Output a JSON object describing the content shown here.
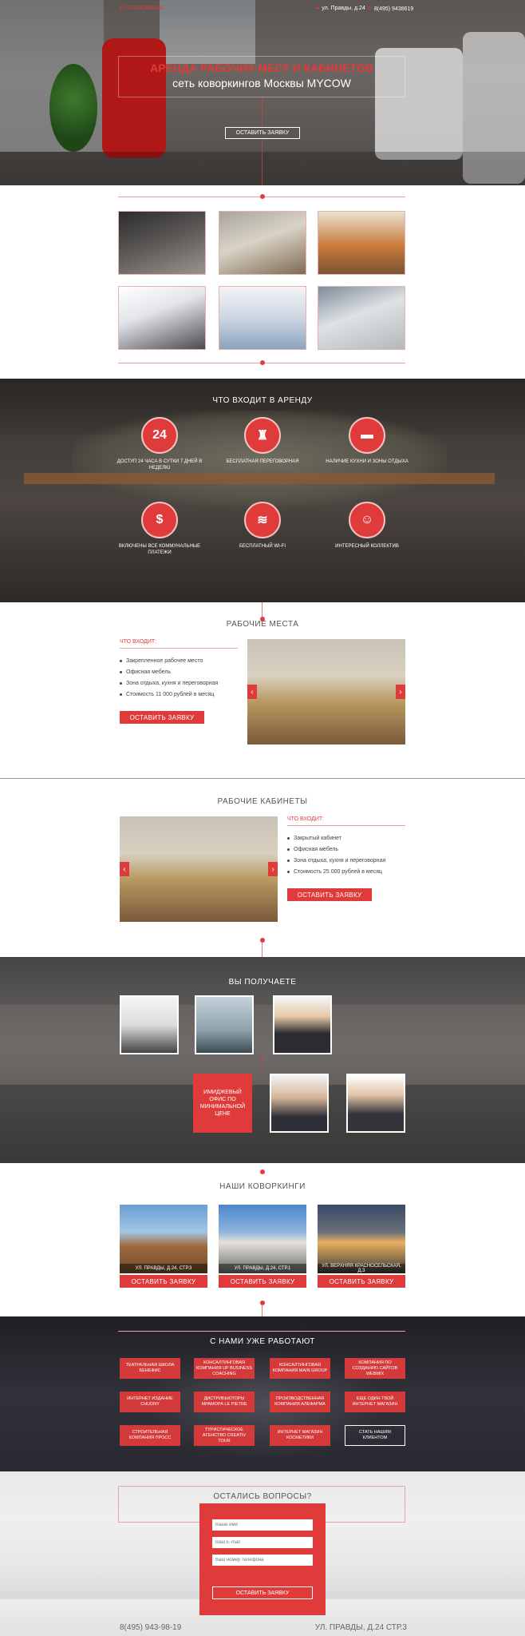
{
  "header": {
    "logo": "MYCOWORKING",
    "address": "ул. Правды, д.24",
    "phone": "8(495) 9438619"
  },
  "hero": {
    "title": "АРЕНДА РАБОЧИХ МЕСТ И КАБИНЕТОВ",
    "subtitle": "сеть коворкингов Москвы MYCOW",
    "button": "ОСТАВИТЬ ЗАЯВКУ"
  },
  "included": {
    "title": "ЧТО ВХОДИТ В АРЕНДУ",
    "features": [
      {
        "icon": "clock-24-icon",
        "glyph": "24",
        "label": "ДОСТУП 24 ЧАСА В СУТКИ 7 ДНЕЙ В НЕДЕЛЮ"
      },
      {
        "icon": "chair-icon",
        "glyph": "♜",
        "label": "БЕСПЛАТНАЯ ПЕРЕГОВОРНАЯ"
      },
      {
        "icon": "sofa-icon",
        "glyph": "▬",
        "label": "НАЛИЧИЕ КУХНИ И ЗОНЫ ОТДЫХА"
      },
      {
        "icon": "money-hand-icon",
        "glyph": "$",
        "label": "ВКЛЮЧЕНЫ ВСЕ КОММУНАЛЬНЫЕ ПЛАТЕЖИ"
      },
      {
        "icon": "wifi-icon",
        "glyph": "≋",
        "label": "БЕСПЛАТНЫЙ WI-FI"
      },
      {
        "icon": "people-icon",
        "glyph": "☺",
        "label": "ИНТЕРЕСНЫЙ КОЛЛЕКТИВ"
      }
    ]
  },
  "workplaces": {
    "title": "РАБОЧИЕ МЕСТА",
    "included_label": "ЧТО ВХОДИТ:",
    "items": [
      "Закрепленное рабочее место",
      "Офисная мебель",
      "Зона отдыха, кухня и переговорная",
      "Стоимость 11 000 рублей в месяц"
    ],
    "button": "ОСТАВИТЬ ЗАЯВКУ"
  },
  "offices": {
    "title": "РАБОЧИЕ КАБИНЕТЫ",
    "included_label": "ЧТО ВХОДИТ:",
    "items": [
      "Закрытый кабинет",
      "Офисная мебель",
      "Зона отдыха, кухня и переговорная",
      "Стоимость 25 000 рублей в месяц"
    ],
    "button": "ОСТАВИТЬ ЗАЯВКУ"
  },
  "youget": {
    "title": "ВЫ ПОЛУЧАЕТЕ",
    "image_block_text": "ИМИДЖЕВЫЙ ОФИС ПО МИНИМАЛЬНОЙ ЦЕНЕ"
  },
  "coworkings": {
    "title": "НАШИ КОВОРКИНГИ",
    "items": [
      {
        "caption": "УЛ. ПРАВДЫ, Д.24, СТР.3",
        "button": "ОСТАВИТЬ ЗАЯВКУ"
      },
      {
        "caption": "УЛ. ПРАВДЫ, Д.24, СТР.1",
        "button": "ОСТАВИТЬ ЗАЯВКУ"
      },
      {
        "caption": "УЛ. ВЕРХНЯЯ КРАСНОСЕЛЬСКАЯ, Д.3",
        "button": "ОСТАВИТЬ ЗАЯВКУ"
      }
    ]
  },
  "clients": {
    "title": "С НАМИ УЖЕ РАБОТАЮТ",
    "items": [
      "ТЕАТРАЛЬНАЯ ШКОЛА БЕНЕФИС",
      "КОНСАЛТИНГОВАЯ КОМПАНИЯ UP BUSINESS COACHING",
      "КОНСАЛТИНГОВАЯ КОМПАНИЯ MAIN GROUP",
      "КОМПАНИЯ ПО СОЗДАНИЮ САЙТОВ WEBMIX",
      "ИНТЕРНЕТ ИЗДАНИЕ CHUDNY",
      "ДИСТРИБЬЮТОРЫ МРАМОРА LE PIETRE",
      "ПРОИЗВОДСТВЕННАЯ КОМПАНИЯ АЛЕФАРМА",
      "ЕЩЕ ОДИН ТВОЙ ИНТЕРНЕТ МАГАЗИН",
      "СТРОИТЕЛЬНАЯ КОМПАНИЯ ПРОСС",
      "ТУРИСТИЧЕСКОЕ АГЕНСТВО CREATIV TOUR",
      "ИНТЕРНЕТ МАГАЗИН КОСМЕТИКИ",
      "СТАТЬ НАШИМ КЛИЕНТОМ"
    ]
  },
  "contact": {
    "title": "ОСТАЛИСЬ ВОПРОСЫ?",
    "name_placeholder": "Ваше имя",
    "email_placeholder": "Ваш E-mail",
    "phone_placeholder": "Ваш номер телефона",
    "button": "ОСТАВИТЬ ЗАЯВКУ",
    "footer_phone": "8(495) 943-98-19",
    "footer_address": "УЛ. ПРАВДЫ, Д.24 СТР.3"
  },
  "colors": {
    "accent": "#e03b3b"
  }
}
